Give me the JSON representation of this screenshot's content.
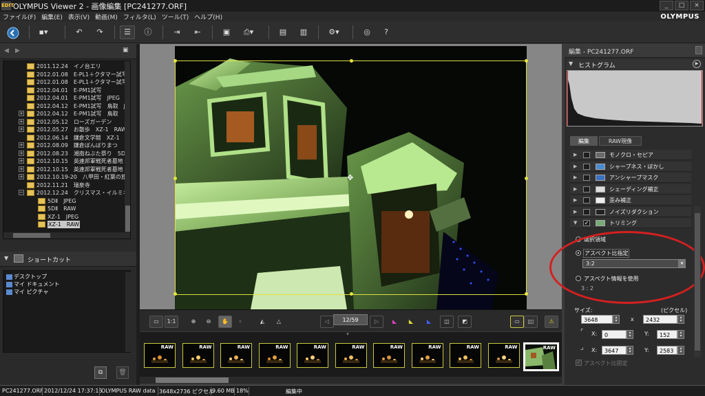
{
  "window": {
    "title": "OLYMPUS Viewer 2 - 画像編集 [PC241277.ORF]",
    "app_icon": "edit-icon",
    "controls": [
      "_",
      "□",
      "×"
    ]
  },
  "brand": "OLYMPUS",
  "menu": [
    "ファイル(F)",
    "編集(E)",
    "表示(V)",
    "動画(M)",
    "フィルタ(L)",
    "ツール(T)",
    "ヘルプ(H)"
  ],
  "tree": {
    "rows": [
      {
        "d": "2011.12.24",
        "t": "イノ台エリ"
      },
      {
        "d": "2012.01.08",
        "t": "E-PL1＋クタマー試写"
      },
      {
        "d": "2012.01.08",
        "t": "E-PL1＋クタマー試写"
      },
      {
        "d": "2012.04.01",
        "t": "E-PM1試写"
      },
      {
        "d": "2012.04.01",
        "t": "E-PM1試写　JPEG"
      },
      {
        "d": "2012.04.12",
        "t": "E-PM1試写　鳥取　J"
      },
      {
        "d": "2012.04.12",
        "t": "E-PM1試写　鳥取"
      },
      {
        "d": "2012.05.12",
        "t": "ローズガーデン"
      },
      {
        "d": "2012.05.27",
        "t": "お散歩　XZ-1　RAW"
      },
      {
        "d": "2012.06.14",
        "t": "鎌倉文学館　XZ-1"
      },
      {
        "d": "2012.08.09",
        "t": "鎌倉ぼんぼりまつ"
      },
      {
        "d": "2012.08.23",
        "t": "湘南ねぶた祭り　5DⅡ"
      },
      {
        "d": "2012.10.15",
        "t": "英連邦軍戦死者墓地"
      },
      {
        "d": "2012.10.15",
        "t": "英連邦軍戦死者墓地"
      },
      {
        "d": "2012.10.19-20",
        "t": "八甲田・紅葉の旅"
      },
      {
        "d": "2012.11.21",
        "t": "瑞泉寺"
      },
      {
        "d": "2012.12.24",
        "t": "クリスマス・イルミネーション"
      }
    ],
    "children": [
      "5DⅡ　JPEG",
      "5DⅡ　RAW",
      "XZ-1　JPEG",
      "XZ-1　RAW"
    ]
  },
  "shortcut": {
    "title": "ショートカット",
    "items": [
      "デスクトップ",
      "マイ ドキュメント",
      "マイ ピクチャ"
    ]
  },
  "viewer": {
    "page": "12/59",
    "zoom_label": "1:1"
  },
  "filmstrip": {
    "raw_label": "RAW",
    "count": 11
  },
  "right": {
    "panel_title": "編集 - PC241277.ORF",
    "histogram_title": "ヒストグラム",
    "tabs": [
      "編集",
      "RAW現像"
    ],
    "effects": [
      "モノクロ・セピア",
      "シャープネス・ぼかし",
      "アンシャープマスク",
      "シェーディング補正",
      "歪み補正",
      "ノイズリダクション",
      "トリミング"
    ],
    "crop": {
      "opt1": "選択領域",
      "opt2": "アスペクト比指定",
      "ratio": "3:2",
      "opt3": "アスペクト情報を使用",
      "opt3_value": "3 : 2",
      "size_label": "サイズ:",
      "unit_label": "(ピクセル)",
      "w": "3648",
      "h": "2432",
      "x_sep": "x",
      "x_label": "X:",
      "y_label": "Y:",
      "x0": "0",
      "y0": "152",
      "x1": "3647",
      "y1": "2583",
      "fix_label": "アスペクト比固定"
    }
  },
  "status": {
    "file": "PC241277.ORF",
    "date": "2012/12/24 17:37:15",
    "format": "OLYMPUS RAW data",
    "dims": "3648x2736 ピクセル",
    "size": "9.60 MB",
    "zoom": "18%",
    "mode": "編集中"
  },
  "colors": {
    "crop": "#e0e040",
    "annotation": "#d42020",
    "panel": "#2c2c2c"
  }
}
